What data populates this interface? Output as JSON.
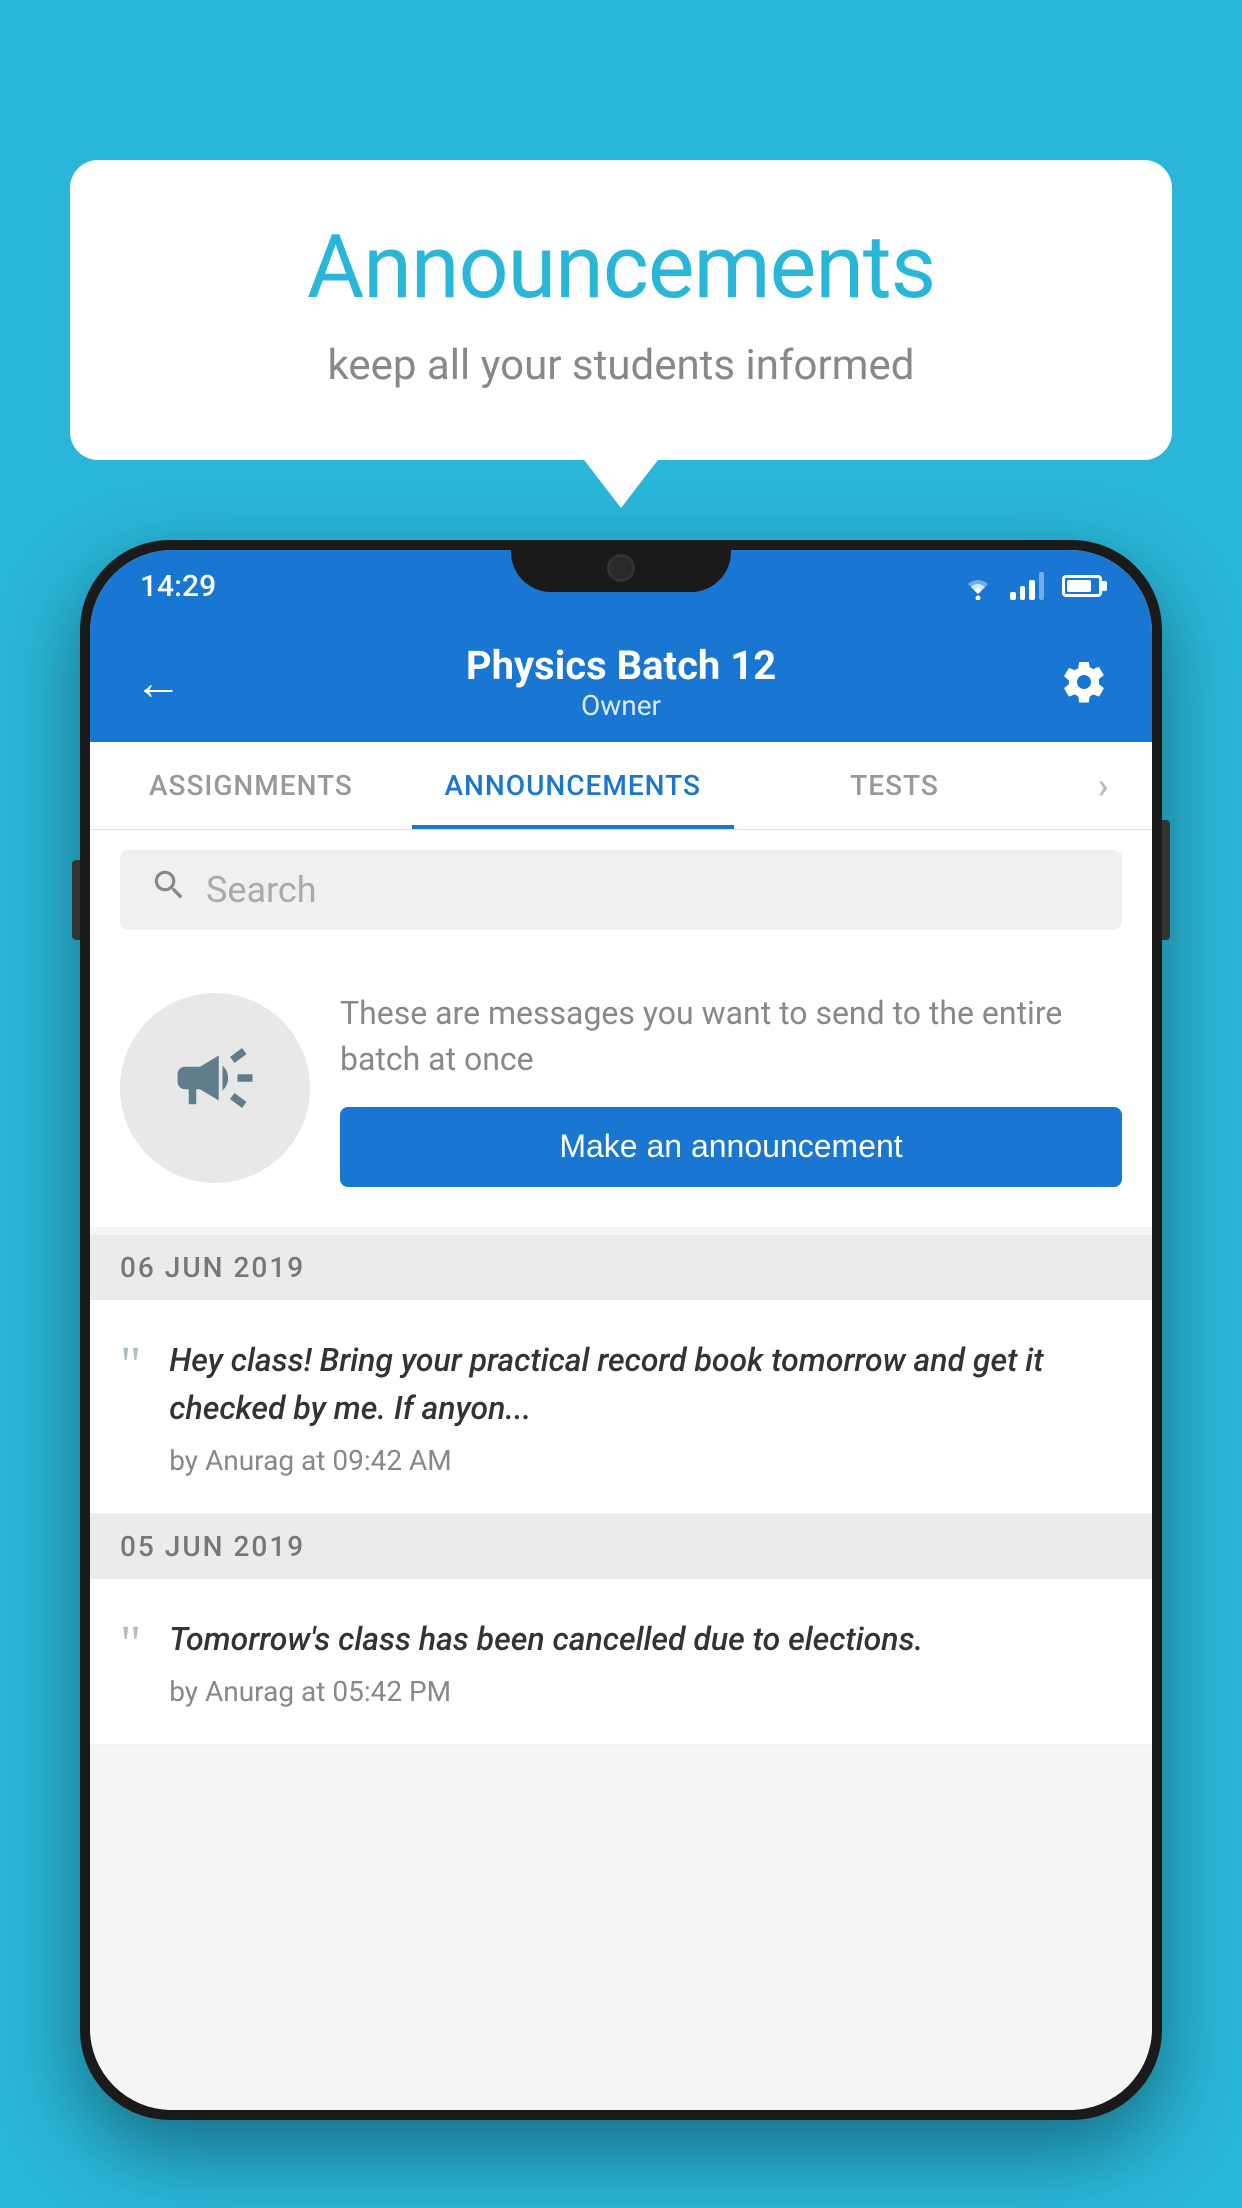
{
  "background_color": "#29B6D8",
  "speech_bubble": {
    "title": "Announcements",
    "subtitle": "keep all your students informed"
  },
  "phone": {
    "status_bar": {
      "time": "14:29",
      "wifi": "▼",
      "battery_percent": 70
    },
    "header": {
      "title": "Physics Batch 12",
      "subtitle": "Owner",
      "back_label": "←",
      "settings_label": "⚙"
    },
    "tabs": [
      {
        "label": "ASSIGNMENTS",
        "active": false
      },
      {
        "label": "ANNOUNCEMENTS",
        "active": true
      },
      {
        "label": "TESTS",
        "active": false
      },
      {
        "label": "›",
        "active": false
      }
    ],
    "search": {
      "placeholder": "Search"
    },
    "promo": {
      "description": "These are messages you want to send to the entire batch at once",
      "button_label": "Make an announcement"
    },
    "announcements": [
      {
        "date": "06  JUN  2019",
        "text": "Hey class! Bring your practical record book tomorrow and get it checked by me. If anyon...",
        "author": "by Anurag at 09:42 AM"
      },
      {
        "date": "05  JUN  2019",
        "text": "Tomorrow's class has been cancelled due to elections.",
        "author": "by Anurag at 05:42 PM"
      }
    ]
  }
}
